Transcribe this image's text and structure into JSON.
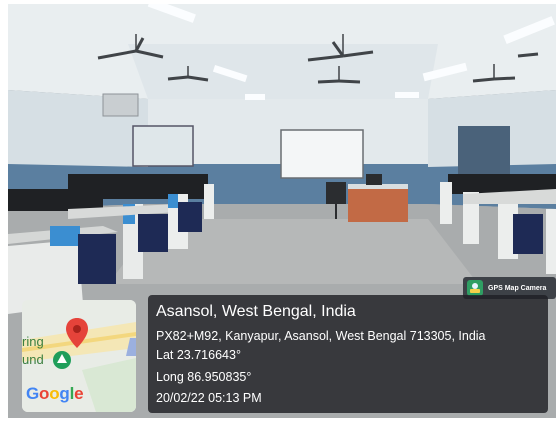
{
  "overlay": {
    "badge_text": "GPS Map Camera",
    "location_title": "Asansol, West Bengal, India",
    "address": "PX82+M92, Kanyapur, Asansol, West Bengal 713305, India",
    "latitude": "Lat 23.716643°",
    "longitude": "Long 86.950835°",
    "datetime": "20/02/22 05:13 PM"
  },
  "map": {
    "label_partial_1": "ring",
    "label_partial_2": "und",
    "logo_text": "Google",
    "pin_color": "#e5433a"
  },
  "scene": {
    "description_icons": [
      "ceiling-fan-icon",
      "lamp-icon",
      "map-pin-icon"
    ]
  }
}
